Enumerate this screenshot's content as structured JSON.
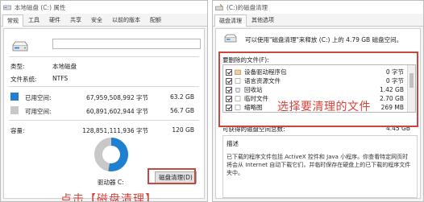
{
  "left_window": {
    "title": "本地磁盘 (C:) 属性",
    "tabs": [
      "常规",
      "工具",
      "硬件",
      "共享",
      "安全",
      "以前的版本",
      "配额"
    ],
    "active_tab": 0,
    "drive_name_value": "",
    "type_label": "类型:",
    "type_value": "本地磁盘",
    "fs_label": "文件系统:",
    "fs_value": "NTFS",
    "used": {
      "label": "已用空间:",
      "bytes": "67,959,508,992 字节",
      "gb": "63.2 GB",
      "color": "#1f7fd1"
    },
    "free": {
      "label": "可用空间:",
      "bytes": "60,891,602,944 字节",
      "gb": "56.7 GB",
      "color": "#c8c8c8"
    },
    "capacity": {
      "label": "容量:",
      "bytes": "128,851,111,936 字节",
      "gb": "120 GB"
    },
    "used_fraction": 0.527,
    "drive_caption": "驱动器 C:",
    "cleanup_button": "磁盘清理(D)",
    "annotation": "点击【磁盘清理】",
    "annotation_color": "#d7423a"
  },
  "right_window": {
    "title": "(C:)的磁盘清理",
    "tabs": [
      "磁盘清理",
      "其他选项"
    ],
    "active_tab": 0,
    "intro": "可以使用\"磁盘清理\"来释放 (C:) 上的 4.79 GB 磁盘空间。",
    "files_label": "要删除的文件(F):",
    "files": [
      {
        "name": "设备驱动程序包",
        "size": "0 字节",
        "checked": true,
        "icon": "package-icon"
      },
      {
        "name": "语言资源文件",
        "size": "0 字节",
        "checked": true,
        "icon": "file-icon"
      },
      {
        "name": "回收站",
        "size": "1.42 GB",
        "checked": true,
        "icon": "recycle-bin-icon"
      },
      {
        "name": "临时文件",
        "size": "2.70 GB",
        "checked": true,
        "icon": "file-icon"
      },
      {
        "name": "缩略图",
        "size": "269 MB",
        "checked": true,
        "icon": "file-icon"
      }
    ],
    "total_label": "可获得的磁盘空间总数:",
    "total_value": "4.45 GB",
    "desc_title": "描述",
    "desc_text": "已下载的程序文件包括 ActiveX 控件和 Java 小程序。你查看特定网页时将会从 Internet 自动下载它们，并临时保存在硬盘上的已下载的程序文件夹中。",
    "annotation": "选择要清理的文件",
    "annotation_color": "#d7423a"
  }
}
